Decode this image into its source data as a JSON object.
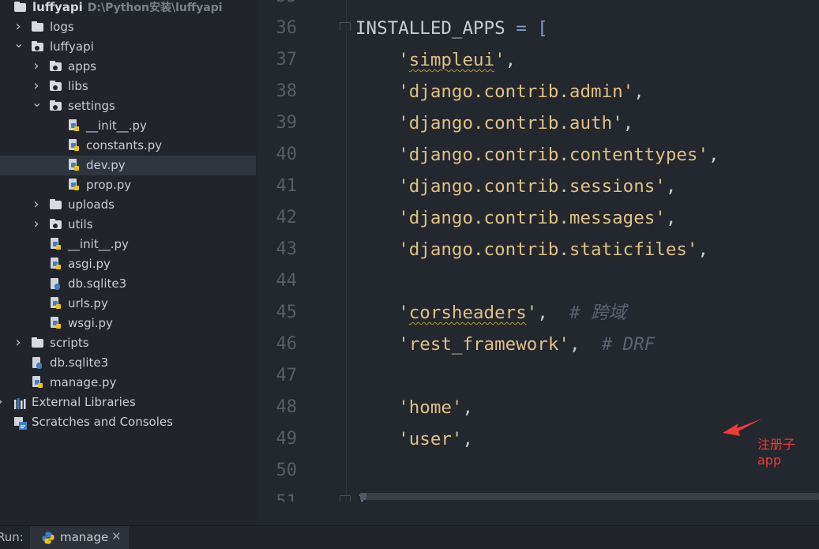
{
  "tree": {
    "rows": [
      {
        "name": "tree-root-luffyapi",
        "label": "luffyapi",
        "path": "D:\\Python安装\\luffyapi",
        "indent": 0,
        "arrow": "",
        "icon": "folder",
        "bold": true
      },
      {
        "name": "tree-item-logs",
        "label": "logs",
        "indent": 1,
        "arrow": "right",
        "icon": "folder"
      },
      {
        "name": "tree-item-luffyapi",
        "label": "luffyapi",
        "indent": 1,
        "arrow": "down",
        "icon": "package"
      },
      {
        "name": "tree-item-apps",
        "label": "apps",
        "indent": 2,
        "arrow": "right",
        "icon": "package"
      },
      {
        "name": "tree-item-libs",
        "label": "libs",
        "indent": 2,
        "arrow": "right",
        "icon": "package"
      },
      {
        "name": "tree-item-settings",
        "label": "settings",
        "indent": 2,
        "arrow": "down",
        "icon": "package"
      },
      {
        "name": "tree-item-settings-init",
        "label": "__init__.py",
        "indent": 3,
        "arrow": "",
        "icon": "python"
      },
      {
        "name": "tree-item-constants",
        "label": "constants.py",
        "indent": 3,
        "arrow": "",
        "icon": "python"
      },
      {
        "name": "tree-item-dev",
        "label": "dev.py",
        "indent": 3,
        "arrow": "",
        "icon": "python",
        "selected": true
      },
      {
        "name": "tree-item-prop",
        "label": "prop.py",
        "indent": 3,
        "arrow": "",
        "icon": "python"
      },
      {
        "name": "tree-item-uploads",
        "label": "uploads",
        "indent": 2,
        "arrow": "right",
        "icon": "folder"
      },
      {
        "name": "tree-item-utils",
        "label": "utils",
        "indent": 2,
        "arrow": "right",
        "icon": "package"
      },
      {
        "name": "tree-item-pkg-init",
        "label": "__init__.py",
        "indent": 2,
        "arrow": "",
        "icon": "python"
      },
      {
        "name": "tree-item-asgi",
        "label": "asgi.py",
        "indent": 2,
        "arrow": "",
        "icon": "python"
      },
      {
        "name": "tree-item-inner-db",
        "label": "db.sqlite3",
        "indent": 2,
        "arrow": "",
        "icon": "db"
      },
      {
        "name": "tree-item-urls",
        "label": "urls.py",
        "indent": 2,
        "arrow": "",
        "icon": "python"
      },
      {
        "name": "tree-item-wsgi",
        "label": "wsgi.py",
        "indent": 2,
        "arrow": "",
        "icon": "python"
      },
      {
        "name": "tree-item-scripts",
        "label": "scripts",
        "indent": 1,
        "arrow": "right",
        "icon": "folder"
      },
      {
        "name": "tree-item-db",
        "label": "db.sqlite3",
        "indent": 1,
        "arrow": "",
        "icon": "db"
      },
      {
        "name": "tree-item-manage",
        "label": "manage.py",
        "indent": 1,
        "arrow": "",
        "icon": "python"
      },
      {
        "name": "tree-item-external-libraries",
        "label": "External Libraries",
        "indent": 0,
        "arrow": "right",
        "icon": "library"
      },
      {
        "name": "tree-item-scratches",
        "label": "Scratches and Consoles",
        "indent": 0,
        "arrow": "",
        "icon": "scratch"
      }
    ]
  },
  "editor": {
    "top_partial_line": "35",
    "bottom_partial_line": "51",
    "lines": [
      {
        "num": "36",
        "parts": [
          {
            "t": "INSTALLED_APPS ",
            "c": "plain"
          },
          {
            "t": "= [",
            "c": "op"
          }
        ],
        "fold": true
      },
      {
        "num": "37",
        "parts": [
          {
            "t": "    ",
            "c": "plain"
          },
          {
            "t": "'",
            "c": "str"
          },
          {
            "t": "simpleui",
            "c": "str squig"
          },
          {
            "t": "'",
            "c": "str"
          },
          {
            "t": ",",
            "c": "plain"
          }
        ]
      },
      {
        "num": "38",
        "parts": [
          {
            "t": "    ",
            "c": "plain"
          },
          {
            "t": "'django.contrib.admin'",
            "c": "str"
          },
          {
            "t": ",",
            "c": "plain"
          }
        ]
      },
      {
        "num": "39",
        "parts": [
          {
            "t": "    ",
            "c": "plain"
          },
          {
            "t": "'django.contrib.auth'",
            "c": "str"
          },
          {
            "t": ",",
            "c": "plain"
          }
        ]
      },
      {
        "num": "40",
        "parts": [
          {
            "t": "    ",
            "c": "plain"
          },
          {
            "t": "'django.contrib.contenttypes'",
            "c": "str"
          },
          {
            "t": ",",
            "c": "plain"
          }
        ]
      },
      {
        "num": "41",
        "parts": [
          {
            "t": "    ",
            "c": "plain"
          },
          {
            "t": "'django.contrib.sessions'",
            "c": "str"
          },
          {
            "t": ",",
            "c": "plain"
          }
        ]
      },
      {
        "num": "42",
        "parts": [
          {
            "t": "    ",
            "c": "plain"
          },
          {
            "t": "'django.contrib.messages'",
            "c": "str"
          },
          {
            "t": ",",
            "c": "plain"
          }
        ]
      },
      {
        "num": "43",
        "parts": [
          {
            "t": "    ",
            "c": "plain"
          },
          {
            "t": "'django.contrib.staticfiles'",
            "c": "str"
          },
          {
            "t": ",",
            "c": "plain"
          }
        ]
      },
      {
        "num": "44",
        "parts": []
      },
      {
        "num": "45",
        "parts": [
          {
            "t": "    ",
            "c": "plain"
          },
          {
            "t": "'",
            "c": "str"
          },
          {
            "t": "corsheaders",
            "c": "str squig"
          },
          {
            "t": "'",
            "c": "str"
          },
          {
            "t": ",  ",
            "c": "plain"
          },
          {
            "t": "# 跨域",
            "c": "com"
          }
        ]
      },
      {
        "num": "46",
        "parts": [
          {
            "t": "    ",
            "c": "plain"
          },
          {
            "t": "'rest_framework'",
            "c": "str"
          },
          {
            "t": ",  ",
            "c": "plain"
          },
          {
            "t": "# DRF",
            "c": "com"
          }
        ]
      },
      {
        "num": "47",
        "parts": []
      },
      {
        "num": "48",
        "parts": [
          {
            "t": "    ",
            "c": "plain"
          },
          {
            "t": "'home'",
            "c": "str"
          },
          {
            "t": ",",
            "c": "plain"
          }
        ]
      },
      {
        "num": "49",
        "parts": [
          {
            "t": "    ",
            "c": "plain"
          },
          {
            "t": "'user'",
            "c": "str"
          },
          {
            "t": ",",
            "c": "plain"
          }
        ]
      },
      {
        "num": "50",
        "parts": []
      }
    ],
    "closing_bracket": "]",
    "annotation": "注册子app"
  },
  "run": {
    "label": "Run:",
    "tab_label": "manage",
    "close_glyph": "✕"
  },
  "colors": {
    "accent": "#dfc184",
    "annotation": "#ee3a3a",
    "background": "#23272e",
    "sidebar": "#21252b"
  }
}
